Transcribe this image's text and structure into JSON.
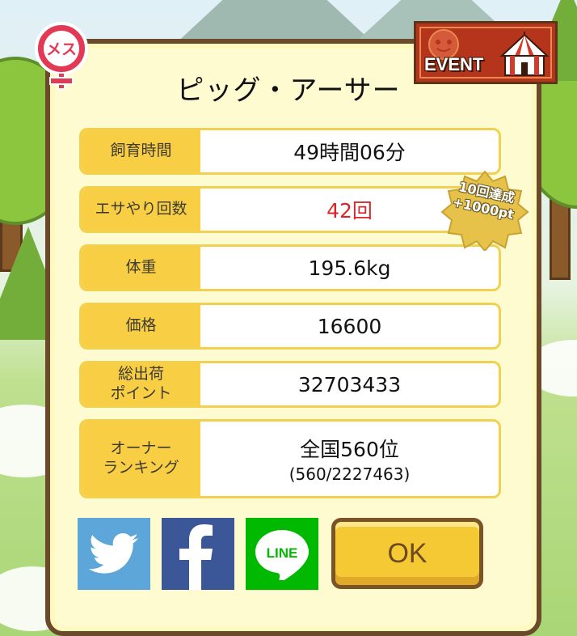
{
  "pig_name": "ピッグ・アーサー",
  "gender": {
    "icon": "female-symbol-icon",
    "label": "メス",
    "color": "#e23a55"
  },
  "event_badge": {
    "label": "EVENT",
    "icon": "circus-tent-icon"
  },
  "stats": [
    {
      "label": "飼育時間",
      "value": "49時間06分"
    },
    {
      "label": "エサやり回数",
      "value": "42回",
      "value_color": "#d8262b"
    },
    {
      "label": "体重",
      "value": "195.6kg"
    },
    {
      "label": "価格",
      "value": "16600"
    },
    {
      "label": "総出荷\nポイント",
      "value": "32703433"
    },
    {
      "label": "オーナー\nランキング",
      "value": "全国560位",
      "sub_value": "(560/2227463)"
    }
  ],
  "bonus_badge": {
    "line1": "10回達成",
    "line2": "+1000pt"
  },
  "share": {
    "twitter_icon": "twitter-bird-icon",
    "facebook_icon": "facebook-f-icon",
    "line_label": "LINE"
  },
  "ok_label": "OK"
}
